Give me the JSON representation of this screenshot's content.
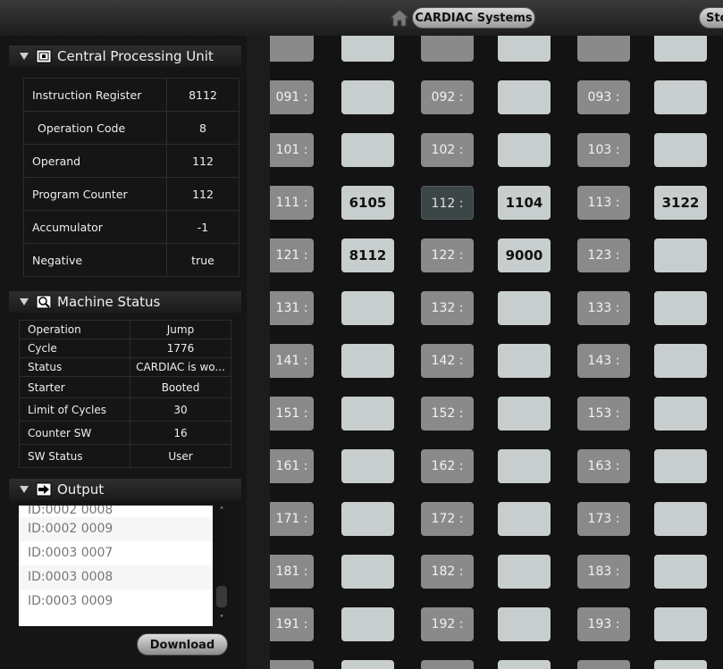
{
  "topbar": {
    "app_title": "CARDIAC Systems",
    "store_label": "Sto",
    "home_icon": "home-icon"
  },
  "cpu": {
    "title": "Central Processing Unit",
    "rows": [
      {
        "label": "Instruction Register",
        "value": "8112"
      },
      {
        "label": "Operation Code",
        "value": "8"
      },
      {
        "label": "Operand",
        "value": "112"
      },
      {
        "label": "Program Counter",
        "value": "112"
      },
      {
        "label": "Accumulator",
        "value": "-1"
      },
      {
        "label": "Negative",
        "value": "true"
      }
    ]
  },
  "machine_status": {
    "title": "Machine Status",
    "rows": [
      {
        "label": "Operation",
        "value": "Jump"
      },
      {
        "label": "Cycle",
        "value": "1776"
      },
      {
        "label": "Status",
        "value": "CARDIAC is wo..."
      },
      {
        "label": "Starter",
        "value": "Booted"
      },
      {
        "label": "Limit of Cycles",
        "value": "30"
      },
      {
        "label": "Counter SW",
        "value": "16"
      },
      {
        "label": "SW Status",
        "value": "User"
      }
    ]
  },
  "output": {
    "title": "Output",
    "lines": [
      "ID:0002 0008",
      "ID:0002 0009",
      "ID:0003 0007",
      "ID:0003 0008",
      "ID:0003 0009"
    ],
    "download_label": "Download"
  },
  "memory": {
    "active_address": "112 :",
    "rows": [
      [
        {
          "addr": "091 :",
          "val": ""
        },
        {
          "addr": "092 :",
          "val": ""
        },
        {
          "addr": "093 :",
          "val": ""
        }
      ],
      [
        {
          "addr": "101 :",
          "val": ""
        },
        {
          "addr": "102 :",
          "val": ""
        },
        {
          "addr": "103 :",
          "val": ""
        }
      ],
      [
        {
          "addr": "111 :",
          "val": "6105"
        },
        {
          "addr": "112 :",
          "val": "1104"
        },
        {
          "addr": "113 :",
          "val": "3122"
        }
      ],
      [
        {
          "addr": "121 :",
          "val": "8112"
        },
        {
          "addr": "122 :",
          "val": "9000"
        },
        {
          "addr": "123 :",
          "val": ""
        }
      ],
      [
        {
          "addr": "131 :",
          "val": ""
        },
        {
          "addr": "132 :",
          "val": ""
        },
        {
          "addr": "133 :",
          "val": ""
        }
      ],
      [
        {
          "addr": "141 :",
          "val": ""
        },
        {
          "addr": "142 :",
          "val": ""
        },
        {
          "addr": "143 :",
          "val": ""
        }
      ],
      [
        {
          "addr": "151 :",
          "val": ""
        },
        {
          "addr": "152 :",
          "val": ""
        },
        {
          "addr": "153 :",
          "val": ""
        }
      ],
      [
        {
          "addr": "161 :",
          "val": ""
        },
        {
          "addr": "162 :",
          "val": ""
        },
        {
          "addr": "163 :",
          "val": ""
        }
      ],
      [
        {
          "addr": "171 :",
          "val": ""
        },
        {
          "addr": "172 :",
          "val": ""
        },
        {
          "addr": "173 :",
          "val": ""
        }
      ],
      [
        {
          "addr": "181 :",
          "val": ""
        },
        {
          "addr": "182 :",
          "val": ""
        },
        {
          "addr": "183 :",
          "val": ""
        }
      ],
      [
        {
          "addr": "191 :",
          "val": ""
        },
        {
          "addr": "192 :",
          "val": ""
        },
        {
          "addr": "193 :",
          "val": ""
        }
      ]
    ]
  }
}
